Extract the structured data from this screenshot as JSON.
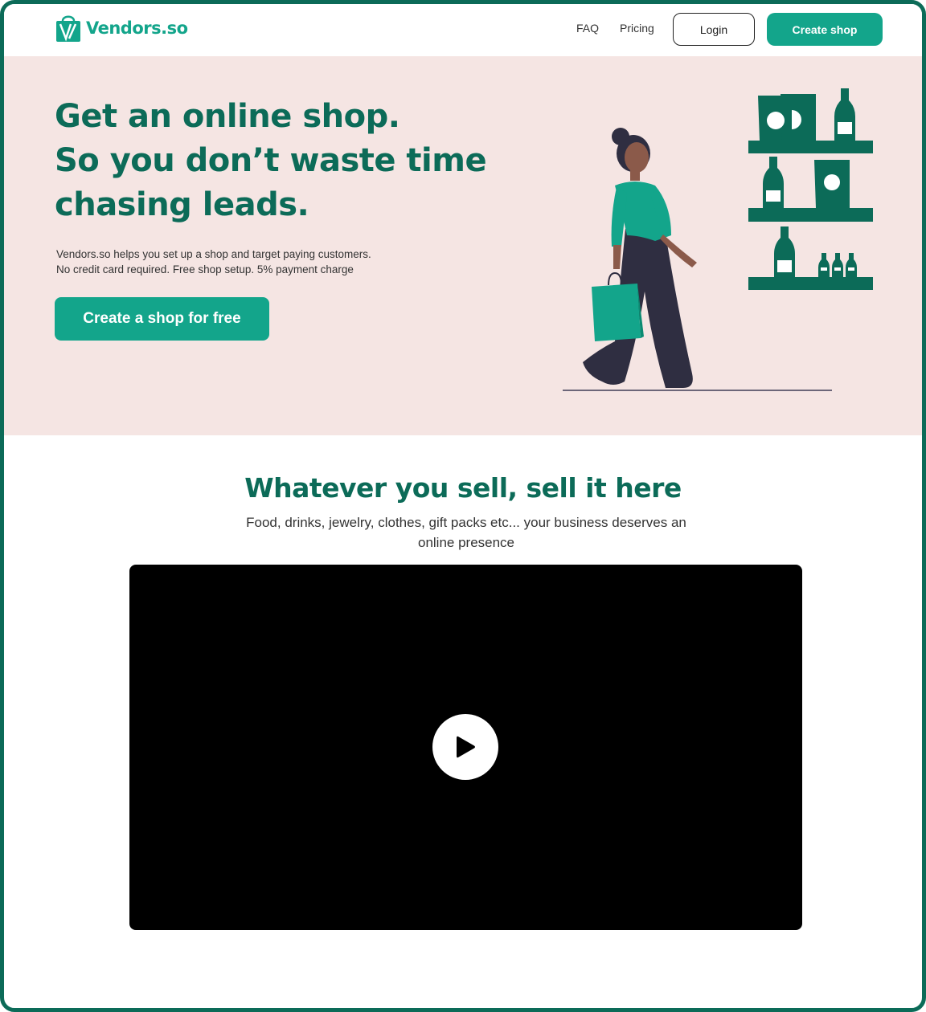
{
  "header": {
    "brand": "Vendors.so",
    "nav": {
      "faq": "FAQ",
      "pricing": "Pricing"
    },
    "login_label": "Login",
    "create_label": "Create shop"
  },
  "hero": {
    "title_lines": [
      "Get an online shop.",
      "So you don’t waste time",
      "chasing leads."
    ],
    "sub_lines": [
      "Vendors.so helps you set up a shop and target paying customers.",
      "No credit card required. Free shop setup. 5% payment charge"
    ],
    "cta_label": "Create a shop for free"
  },
  "section": {
    "title": "Whatever you sell, sell it here",
    "subtitle": "Food, drinks, jewelry, clothes, gift packs etc... your business deserves an online presence"
  },
  "icons": {
    "logo": "shopping-bag-logo-icon",
    "play": "play-icon"
  },
  "colors": {
    "brand": "#13a58b",
    "brand_dark": "#0c6b58",
    "hero_bg": "#f5e5e3",
    "frame": "#0c6b58"
  }
}
